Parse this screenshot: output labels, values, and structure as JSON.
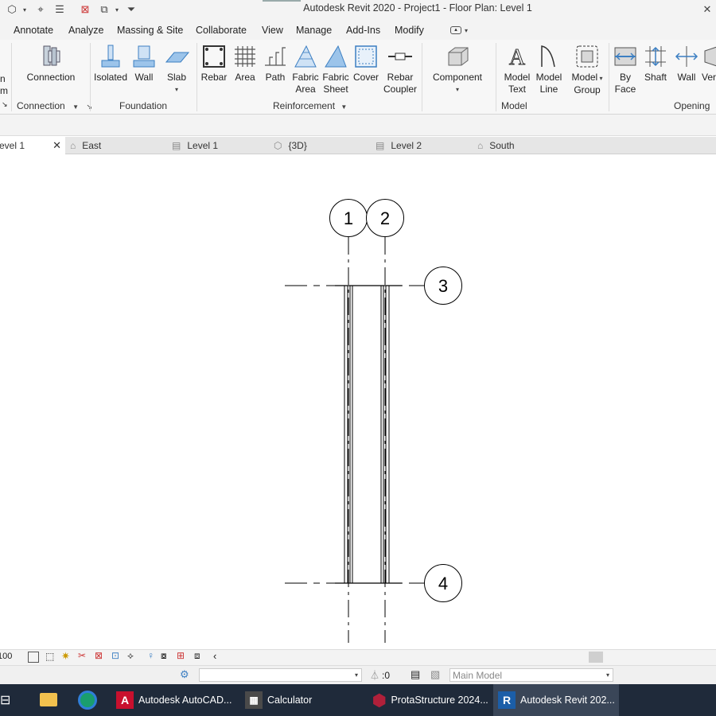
{
  "window": {
    "title": "Autodesk Revit 2020 - Project1 - Floor Plan: Level 1"
  },
  "menu_tabs": [
    "Annotate",
    "Analyze",
    "Massing & Site",
    "Collaborate",
    "View",
    "Manage",
    "Add-Ins",
    "Modify"
  ],
  "ribbon": {
    "partial_left": [
      "n",
      "m"
    ],
    "connection": {
      "button": "Connection",
      "panel": "Connection"
    },
    "foundation": {
      "buttons": [
        "Isolated",
        "Wall",
        "Slab"
      ],
      "panel": "Foundation"
    },
    "reinforcement": {
      "buttons": [
        {
          "line1": "Rebar",
          "line2": ""
        },
        {
          "line1": "Area",
          "line2": ""
        },
        {
          "line1": "Path",
          "line2": ""
        },
        {
          "line1": "Fabric",
          "line2": "Area"
        },
        {
          "line1": "Fabric",
          "line2": "Sheet"
        },
        {
          "line1": "Cover",
          "line2": ""
        },
        {
          "line1": "Rebar",
          "line2": "Coupler"
        }
      ],
      "panel": "Reinforcement"
    },
    "model": {
      "buttons": [
        {
          "line1": "Component",
          "line2": ""
        },
        {
          "line1": "Model",
          "line2": "Text"
        },
        {
          "line1": "Model",
          "line2": "Line"
        },
        {
          "line1": "Model",
          "line2": "Group"
        }
      ],
      "panel": "Model"
    },
    "opening": {
      "buttons": [
        {
          "line1": "By",
          "line2": "Face"
        },
        {
          "line1": "Shaft",
          "line2": ""
        },
        {
          "line1": "Wall",
          "line2": ""
        },
        {
          "line1": "Ver",
          "line2": ""
        }
      ],
      "panel": "Opening"
    }
  },
  "view_tabs": [
    {
      "label": "evel 1",
      "active": true,
      "icon": "floor-plan-icon"
    },
    {
      "label": "East",
      "active": false,
      "icon": "elevation-icon"
    },
    {
      "label": "Level 1",
      "active": false,
      "icon": "floor-plan-icon"
    },
    {
      "label": "{3D}",
      "active": false,
      "icon": "3d-view-icon"
    },
    {
      "label": "Level 2",
      "active": false,
      "icon": "floor-plan-icon"
    },
    {
      "label": "South",
      "active": false,
      "icon": "elevation-icon"
    }
  ],
  "grids": {
    "g1": "1",
    "g2": "2",
    "g3": "3",
    "g4": "4"
  },
  "view_control": {
    "scale": ":100"
  },
  "status": {
    "selection_count": ":0",
    "model": "Main Model"
  },
  "taskbar": [
    {
      "label": "Autodesk AutoCAD...",
      "icon": "autocad-icon",
      "color": "#c8102e"
    },
    {
      "label": "Calculator",
      "icon": "calculator-icon",
      "color": "#4a4a4a"
    },
    {
      "label": "ProtaStructure 2024...",
      "icon": "protastructure-icon",
      "color": "#b0203a"
    },
    {
      "label": "Autodesk Revit 202...",
      "icon": "revit-icon",
      "color": "#1b5ea8"
    }
  ]
}
